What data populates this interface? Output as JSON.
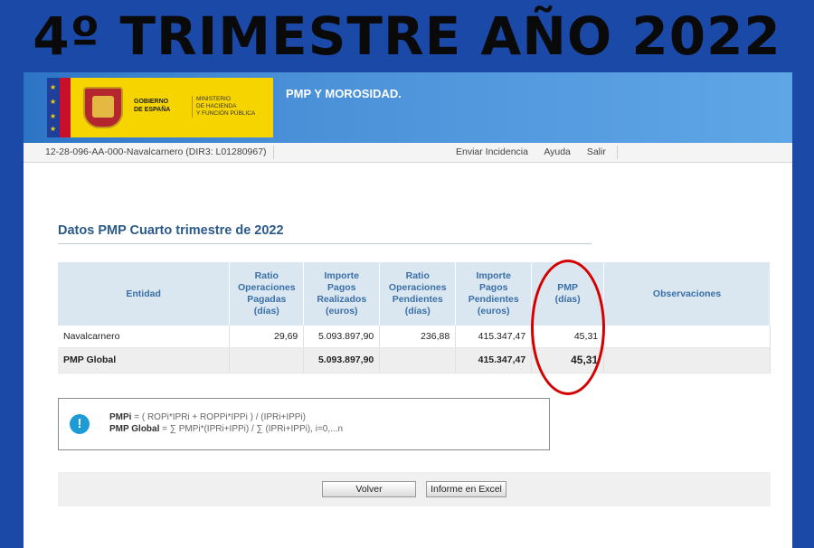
{
  "headline": "4º TRIMESTRE AÑO 2022",
  "header": {
    "gov_line1": "GOBIERNO",
    "gov_line2": "DE ESPAÑA",
    "ministry_line1": "MINISTERIO",
    "ministry_line2": "DE HACIENDA",
    "ministry_line3": "Y FUNCIÓN PÚBLICA",
    "app_title": "PMP Y MOROSIDAD."
  },
  "navbar": {
    "entity": "12-28-096-AA-000-Navalcarnero (DIR3: L01280967)",
    "links": [
      "Enviar Incidencia",
      "Ayuda",
      "Salir"
    ]
  },
  "section_title": "Datos PMP Cuarto trimestre de 2022",
  "table": {
    "headers": {
      "entidad": "Entidad",
      "ratio_pagadas": [
        "Ratio",
        "Operaciones",
        "Pagadas",
        "(días)"
      ],
      "importe_realizados": [
        "Importe",
        "Pagos",
        "Realizados",
        "(euros)"
      ],
      "ratio_pendientes": [
        "Ratio",
        "Operaciones",
        "Pendientes",
        "(días)"
      ],
      "importe_pendientes": [
        "Importe",
        "Pagos",
        "Pendientes",
        "(euros)"
      ],
      "pmp": [
        "PMP",
        "(días)"
      ],
      "observaciones": "Observaciones"
    },
    "rows": [
      {
        "entidad": "Navalcarnero",
        "ratio_pagadas": "29,69",
        "importe_realizados": "5.093.897,90",
        "ratio_pendientes": "236,88",
        "importe_pendientes": "415.347,47",
        "pmp": "45,31",
        "observaciones": ""
      }
    ],
    "global": {
      "entidad": "PMP Global",
      "importe_realizados": "5.093.897,90",
      "importe_pendientes": "415.347,47",
      "pmp": "45,31"
    }
  },
  "formula": {
    "line1_label": "PMPi",
    "line1_text": " = ( ROPi*IPRi + ROPPi*IPPi ) / (IPRi+IPPi)",
    "line2_label": "PMP Global",
    "line2_text": " = ∑ PMPi*(IPRi+IPPi) / ∑ (IPRi+IPPi), i=0,...n"
  },
  "buttons": {
    "back": "Volver",
    "excel": "Informe en Excel"
  },
  "colors": {
    "background": "#1a49a8",
    "banner": "#4a90d8",
    "accent_text": "#2b5a8a",
    "highlight_circle": "#d40000"
  }
}
